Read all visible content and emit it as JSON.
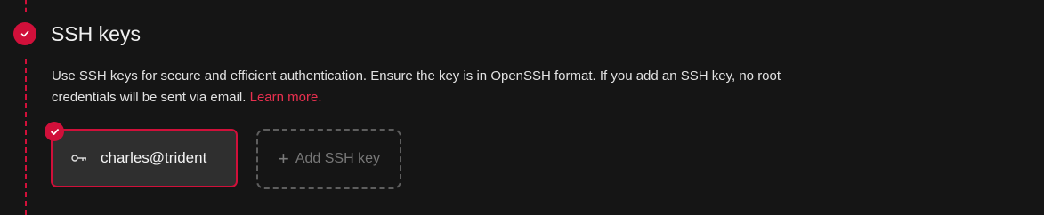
{
  "section": {
    "title": "SSH keys",
    "description": "Use SSH keys for secure and efficient authentication. Ensure the key is in OpenSSH format. If you add an SSH key, no root credentials will be sent via email.",
    "learn_more": "Learn more.",
    "step_icon": "check-icon",
    "accent_color": "#d0103a"
  },
  "ssh_keys": [
    {
      "name": "charles@trident",
      "icon": "key-icon",
      "selected": true
    }
  ],
  "add_button": {
    "label": "Add SSH key",
    "icon": "plus-icon"
  }
}
